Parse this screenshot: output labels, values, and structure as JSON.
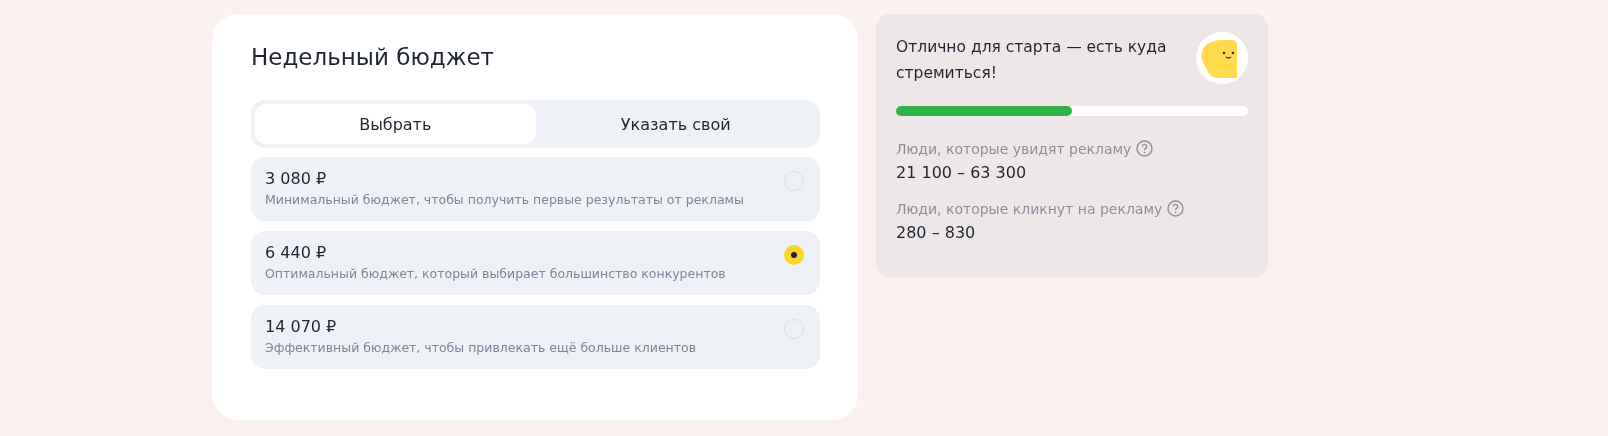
{
  "budget": {
    "title": "Недельный бюджет",
    "tabs": [
      {
        "label": "Выбрать",
        "selected": true
      },
      {
        "label": "Указать свой",
        "selected": false
      }
    ],
    "options": [
      {
        "amount": "3 080 ₽",
        "description": "Минимальный бюджет, чтобы получить первые результаты от рекламы",
        "selected": false
      },
      {
        "amount": "6 440 ₽",
        "description": "Оптимальный бюджет, который выбирает большинство конкурентов",
        "selected": true
      },
      {
        "amount": "14 070 ₽",
        "description": "Эффективный бюджет, чтобы привлекать ещё больше клиентов",
        "selected": false
      }
    ]
  },
  "forecast": {
    "message": "Отлично для старта — есть куда стремиться!",
    "level": 0.5,
    "metrics": [
      {
        "label": "Люди, которые увидят рекламу",
        "value": "21 100 – 63 300"
      },
      {
        "label": "Люди, которые кликнут на рекламу",
        "value": "280 – 830"
      }
    ]
  }
}
